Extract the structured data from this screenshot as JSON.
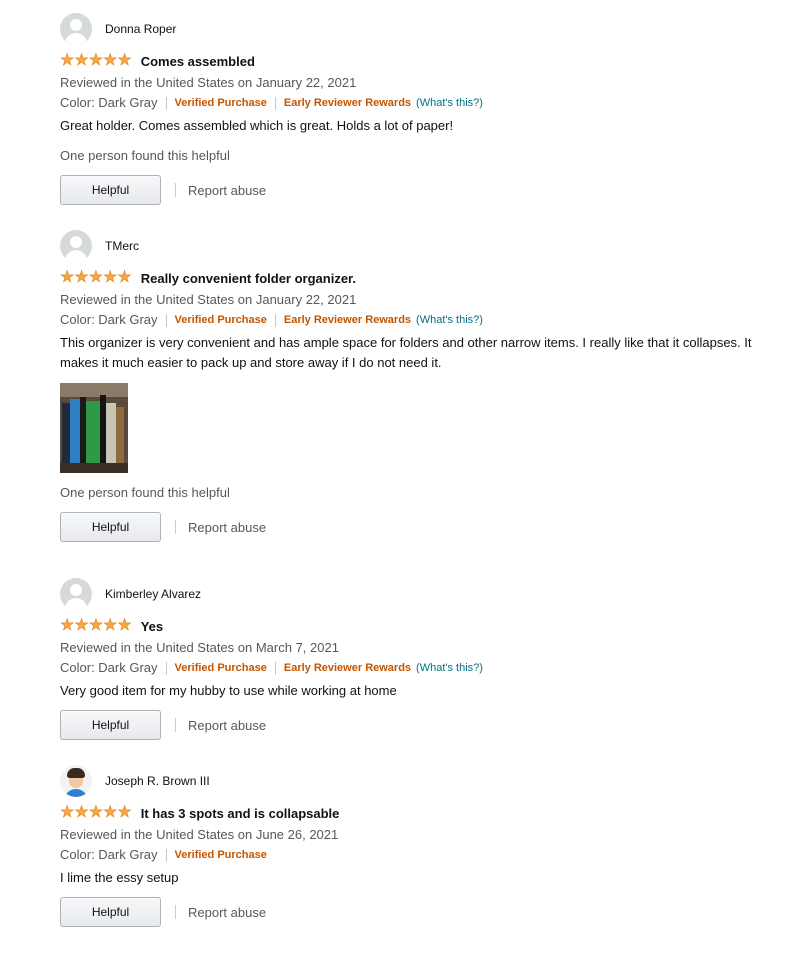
{
  "reviews": [
    {
      "author": "Donna Roper",
      "avatar": "default-avatar",
      "rating": 5,
      "title": "Comes assembled",
      "date_line": "Reviewed in the United States on January 22, 2021",
      "color": "Color: Dark Gray",
      "verified": "Verified Purchase",
      "early_rewards": "Early Reviewer Rewards",
      "whats_this": "(What's this?)",
      "body": "Great holder. Comes assembled which is great. Holds a lot of paper!",
      "helpful_count": "One person found this helpful",
      "helpful_button": "Helpful",
      "report": "Report abuse"
    },
    {
      "author": "TMerc",
      "avatar": "default-avatar",
      "rating": 5,
      "title": "Really convenient folder organizer.",
      "date_line": "Reviewed in the United States on January 22, 2021",
      "color": "Color: Dark Gray",
      "verified": "Verified Purchase",
      "early_rewards": "Early Reviewer Rewards",
      "whats_this": "(What's this?)",
      "body": "This organizer is very convenient and has ample space for folders and other narrow items. I really like that it collapses. It makes it much easier to pack up and store away if I do not need it.",
      "has_photo": true,
      "helpful_count": "One person found this helpful",
      "helpful_button": "Helpful",
      "report": "Report abuse"
    },
    {
      "author": "Kimberley Alvarez",
      "avatar": "default-avatar",
      "rating": 5,
      "title": "Yes",
      "date_line": "Reviewed in the United States on March 7, 2021",
      "color": "Color: Dark Gray",
      "verified": "Verified Purchase",
      "early_rewards": "Early Reviewer Rewards",
      "whats_this": "(What's this?)",
      "body": "Very good item for my hubby to use while working at home",
      "helpful_button": "Helpful",
      "report": "Report abuse"
    },
    {
      "author": "Joseph R. Brown III",
      "avatar": "profile-photo",
      "rating": 5,
      "title": "It has 3 spots and is collapsable",
      "date_line": "Reviewed in the United States on June 26, 2021",
      "color": "Color: Dark Gray",
      "verified": "Verified Purchase",
      "body": "I lime the essy setup",
      "helpful_button": "Helpful",
      "report": "Report abuse"
    }
  ],
  "colors": {
    "star": "#f3a847",
    "verified": "#c45500",
    "link": "#007185",
    "secondary_text": "#565959"
  }
}
